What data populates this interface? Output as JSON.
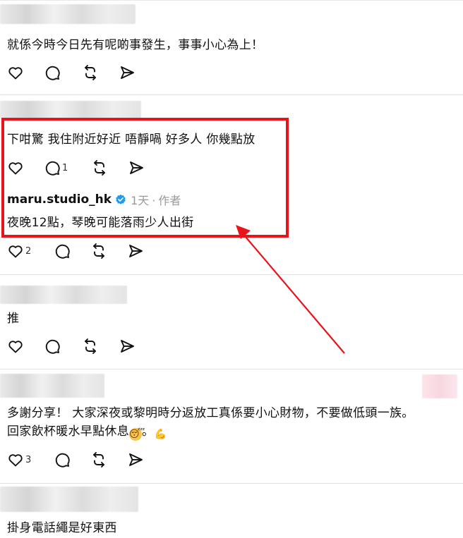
{
  "colors": {
    "highlight": "#e8141a",
    "meta": "#999999",
    "verified": "#1d9bf0"
  },
  "icons": [
    "heart-icon",
    "comment-icon",
    "repost-icon",
    "share-icon",
    "verified-icon"
  ],
  "posts": [
    {
      "text": "就係今時今日先有呢啲事發生，事事小心為上！",
      "likes": "",
      "comments": ""
    },
    {
      "text": "下咁驚 我住附近好近 唔靜喎 好多人 你幾點放",
      "likes": "",
      "comments": "1",
      "reply": {
        "author": "maru.studio_hk",
        "time": "1天",
        "separator": "·",
        "role": "作者",
        "text": "夜晚12點，琴晚可能落雨少人出街",
        "likes": "2",
        "comments": ""
      }
    },
    {
      "text": "推",
      "likes": "",
      "comments": ""
    },
    {
      "text": "多謝分享！ 大家深夜或黎明時分返放工真係要小心財物，不要做低頭一族。",
      "text2": "回家飲杯暖水早點休息",
      "emoji1": "😴",
      "mid": "。",
      "emoji2": "💪",
      "likes": "3",
      "comments": ""
    },
    {
      "text": "掛身電話繩是好東西"
    }
  ]
}
